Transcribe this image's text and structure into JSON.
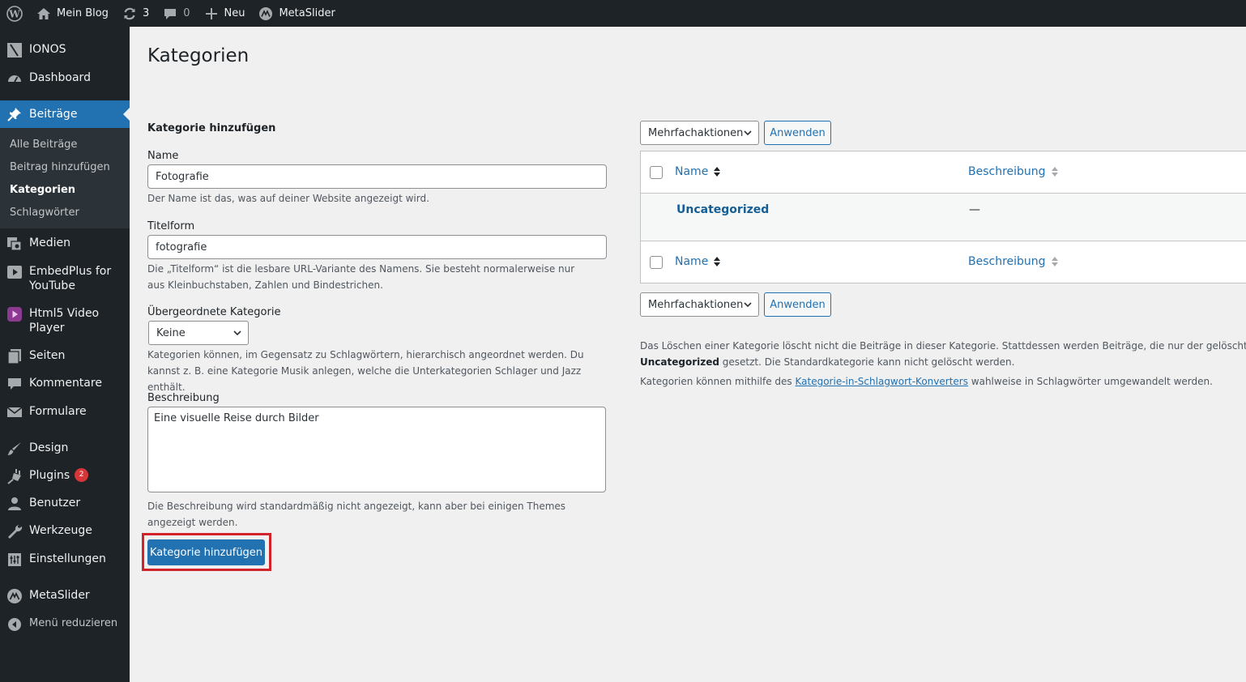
{
  "adminbar": {
    "site_name": "Mein Blog",
    "updates_count": "3",
    "comments_count": "0",
    "new_label": "Neu",
    "metaslider_label": "MetaSlider"
  },
  "sidebar": {
    "items": [
      {
        "label": "IONOS",
        "icon": "ionos-icon"
      },
      {
        "label": "Dashboard",
        "icon": "dashboard-icon"
      },
      {
        "label": "Beiträge",
        "icon": "pin-icon"
      },
      {
        "label": "Medien",
        "icon": "media-icon"
      },
      {
        "label": "EmbedPlus for",
        "label2": "YouTube",
        "icon": "youtube-icon"
      },
      {
        "label": "Html5 Video",
        "label2": "Player",
        "icon": "video-icon"
      },
      {
        "label": "Seiten",
        "icon": "pages-icon"
      },
      {
        "label": "Kommentare",
        "icon": "comment-icon"
      },
      {
        "label": "Formulare",
        "icon": "mail-icon"
      },
      {
        "label": "Design",
        "icon": "brush-icon"
      },
      {
        "label": "Plugins",
        "icon": "plugin-icon",
        "badge": "2"
      },
      {
        "label": "Benutzer",
        "icon": "user-icon"
      },
      {
        "label": "Werkzeuge",
        "icon": "wrench-icon"
      },
      {
        "label": "Einstellungen",
        "icon": "settings-icon"
      },
      {
        "label": "MetaSlider",
        "icon": "metaslider-icon"
      },
      {
        "label": "Menü reduzieren",
        "icon": "collapse-icon"
      }
    ],
    "submenu": [
      "Alle Beiträge",
      "Beitrag hinzufügen",
      "Kategorien",
      "Schlagwörter"
    ]
  },
  "page": {
    "title": "Kategorien"
  },
  "form": {
    "heading": "Kategorie hinzufügen",
    "name_label": "Name",
    "name_value": "Fotografie",
    "name_help": "Der Name ist das, was auf deiner Website angezeigt wird.",
    "slug_label": "Titelform",
    "slug_value": "fotografie",
    "slug_help": "Die „Titelform“ ist die lesbare URL-Variante des Namens. Sie besteht normalerweise nur aus Kleinbuchstaben, Zahlen und Bindestrichen.",
    "parent_label": "Übergeordnete Kategorie",
    "parent_value": "Keine",
    "parent_help": "Kategorien können, im Gegensatz zu Schlagwörtern, hierarchisch angeordnet werden. Du kannst z. B. eine Kategorie Musik anlegen, welche die Unterkategorien Schlager und Jazz enthält.",
    "desc_label": "Beschreibung",
    "desc_value": "Eine visuelle Reise durch Bilder",
    "desc_help": "Die Beschreibung wird standardmäßig nicht angezeigt, kann aber bei einigen Themes angezeigt werden.",
    "submit_label": "Kategorie hinzufügen"
  },
  "list": {
    "bulk_actions": "Mehrfachaktionen",
    "apply": "Anwenden",
    "col_name": "Name",
    "col_desc": "Beschreibung",
    "rows": [
      {
        "name": "Uncategorized",
        "description": "—"
      }
    ],
    "note1_a": "Das Löschen einer Kategorie löscht nicht die Beiträge in dieser Kategorie. Stattdessen werden Beiträge, die nur der gelöschten Kate",
    "note1_b_bold": "Uncategorized",
    "note1_b": " gesetzt. Die Standardkategorie kann nicht gelöscht werden.",
    "note2_a": "Kategorien können mithilfe des ",
    "note2_link": "Kategorie-in-Schlagwort-Konverters",
    "note2_b": " wahlweise in Schlagwörter umgewandelt werden."
  },
  "colors": {
    "accent": "#2271b1",
    "sidebar_bg": "#1d2327",
    "highlight": "#d2232a"
  }
}
